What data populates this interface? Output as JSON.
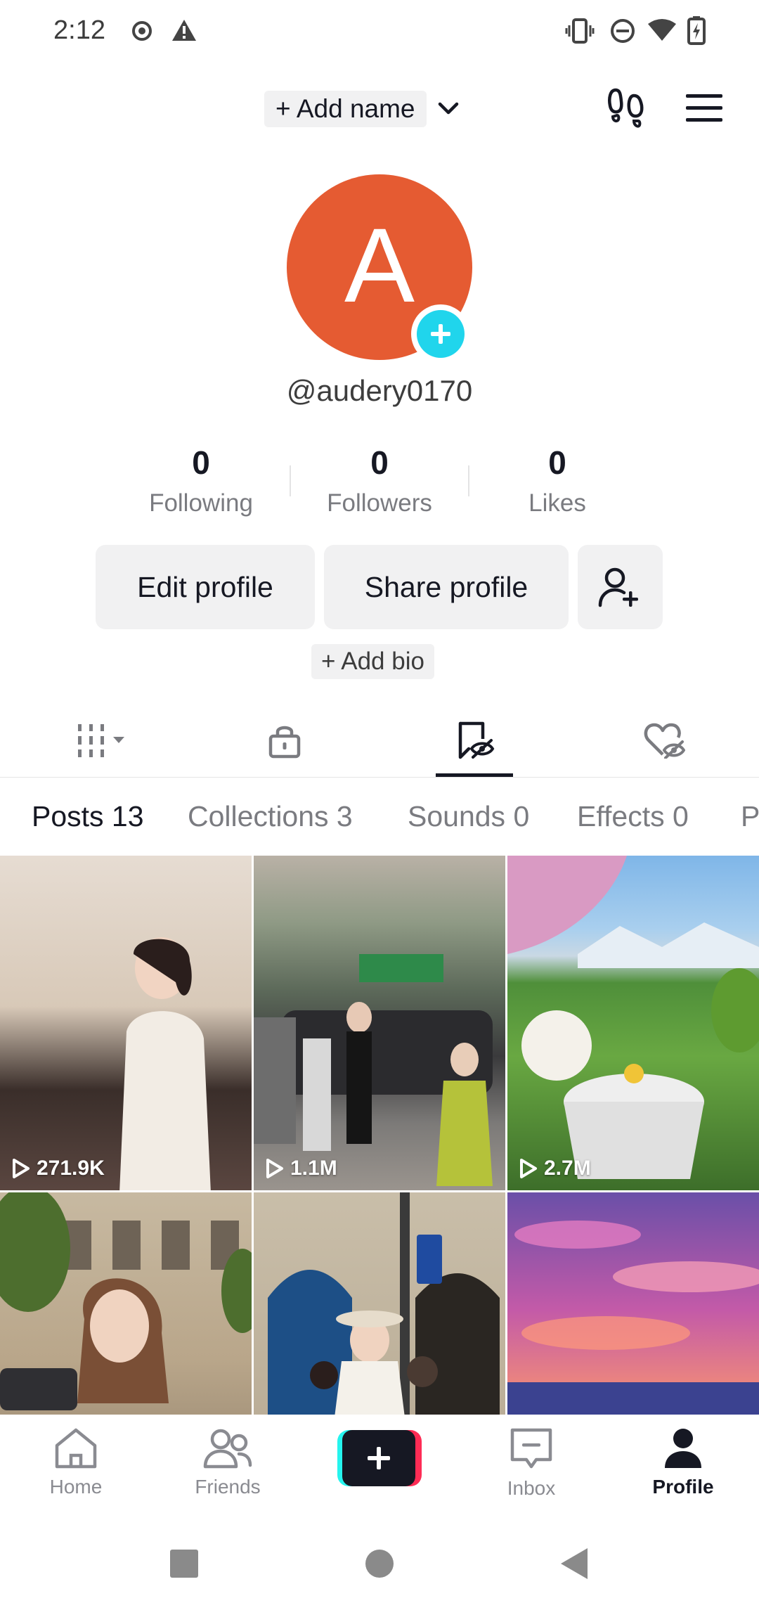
{
  "status_bar": {
    "time": "2:12"
  },
  "top_bar": {
    "add_name": "+ Add name"
  },
  "profile": {
    "avatar_letter": "A",
    "username": "@audery0170",
    "stats": [
      {
        "value": "0",
        "label": "Following"
      },
      {
        "value": "0",
        "label": "Followers"
      },
      {
        "value": "0",
        "label": "Likes"
      }
    ],
    "edit_profile": "Edit profile",
    "share_profile": "Share profile",
    "add_bio": "+ Add bio"
  },
  "content_tabs": [
    {
      "label": "Posts 13",
      "active": true
    },
    {
      "label": "Collections 3",
      "active": false
    },
    {
      "label": "Sounds 0",
      "active": false
    },
    {
      "label": "Effects 0",
      "active": false
    },
    {
      "label": "P",
      "active": false
    }
  ],
  "posts": [
    {
      "views": "271.9K"
    },
    {
      "views": "1.1M"
    },
    {
      "views": "2.7M"
    },
    {
      "views": ""
    },
    {
      "views": ""
    },
    {
      "views": ""
    }
  ],
  "bottom_nav": {
    "home": "Home",
    "friends": "Friends",
    "inbox": "Inbox",
    "profile": "Profile"
  },
  "colors": {
    "avatar": "#e55b32",
    "add_badge": "#20d5ec",
    "create_left": "#25f4ee",
    "create_right": "#fe2c55"
  }
}
